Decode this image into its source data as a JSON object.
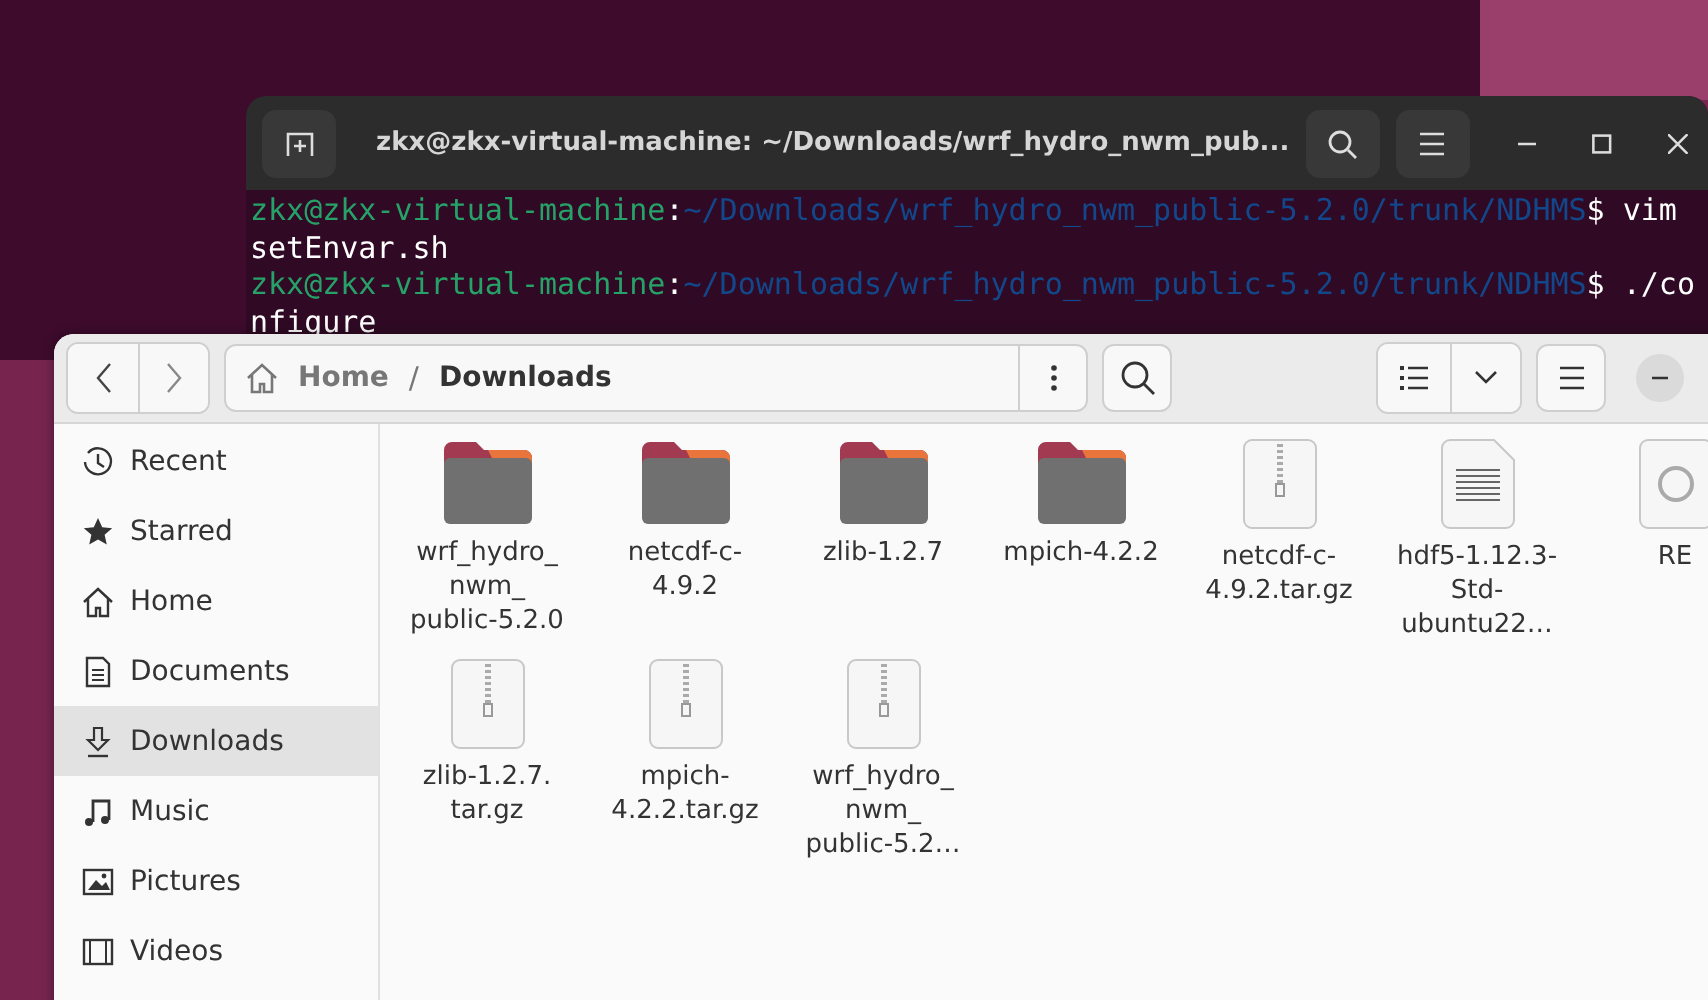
{
  "terminal": {
    "title": "zkx@zkx-virtual-machine: ~/Downloads/wrf_hydro_nwm_pub...",
    "lines": [
      {
        "segments": [
          {
            "kind": "user",
            "text": "zkx@zkx-virtual-machine"
          },
          {
            "kind": "sep",
            "text": ":"
          },
          {
            "kind": "path",
            "text": "~/Downloads/wrf_hydro_nwm_public-5.2.0/trunk/NDHMS"
          },
          {
            "kind": "cmd",
            "text": "$ vim"
          }
        ]
      },
      {
        "segments": [
          {
            "kind": "cmd",
            "text": "setEnvar.sh"
          }
        ]
      },
      {
        "segments": [
          {
            "kind": "user",
            "text": "zkx@zkx-virtual-machine"
          },
          {
            "kind": "sep",
            "text": ":"
          },
          {
            "kind": "path",
            "text": "~/Downloads/wrf_hydro_nwm_public-5.2.0/trunk/NDHMS"
          },
          {
            "kind": "cmd",
            "text": "$ ./co"
          }
        ]
      },
      {
        "segments": [
          {
            "kind": "cmd",
            "text": "nfigure"
          }
        ]
      }
    ]
  },
  "files": {
    "breadcrumb": [
      {
        "label": "Home",
        "current": false
      },
      {
        "label": "Downloads",
        "current": true
      }
    ],
    "breadcrumb_separator": "/",
    "sidebar": [
      {
        "kind": "recent",
        "label": "Recent",
        "selected": false
      },
      {
        "kind": "starred",
        "label": "Starred",
        "selected": false
      },
      {
        "kind": "home",
        "label": "Home",
        "selected": false
      },
      {
        "kind": "documents",
        "label": "Documents",
        "selected": false
      },
      {
        "kind": "downloads",
        "label": "Downloads",
        "selected": true
      },
      {
        "kind": "music",
        "label": "Music",
        "selected": false
      },
      {
        "kind": "pictures",
        "label": "Pictures",
        "selected": false
      },
      {
        "kind": "videos",
        "label": "Videos",
        "selected": false
      }
    ],
    "items": [
      {
        "kind": "folder",
        "name": "wrf_hydro_\nnwm_\npublic-5.2.0"
      },
      {
        "kind": "folder",
        "name": "netcdf-c-\n4.9.2"
      },
      {
        "kind": "folder",
        "name": "zlib-1.2.7"
      },
      {
        "kind": "folder",
        "name": "mpich-4.2.2"
      },
      {
        "kind": "archive",
        "name": "netcdf-c-\n4.9.2.tar.gz"
      },
      {
        "kind": "document",
        "name": "hdf5-1.12.3-\nStd-\nubuntu22…"
      },
      {
        "kind": "generic",
        "name": "RE"
      },
      {
        "kind": "archive",
        "name": "zlib-1.2.7.\ntar.gz"
      },
      {
        "kind": "archive",
        "name": "mpich-\n4.2.2.tar.gz"
      },
      {
        "kind": "archive",
        "name": "wrf_hydro_\nnwm_\npublic-5.2…"
      }
    ]
  }
}
